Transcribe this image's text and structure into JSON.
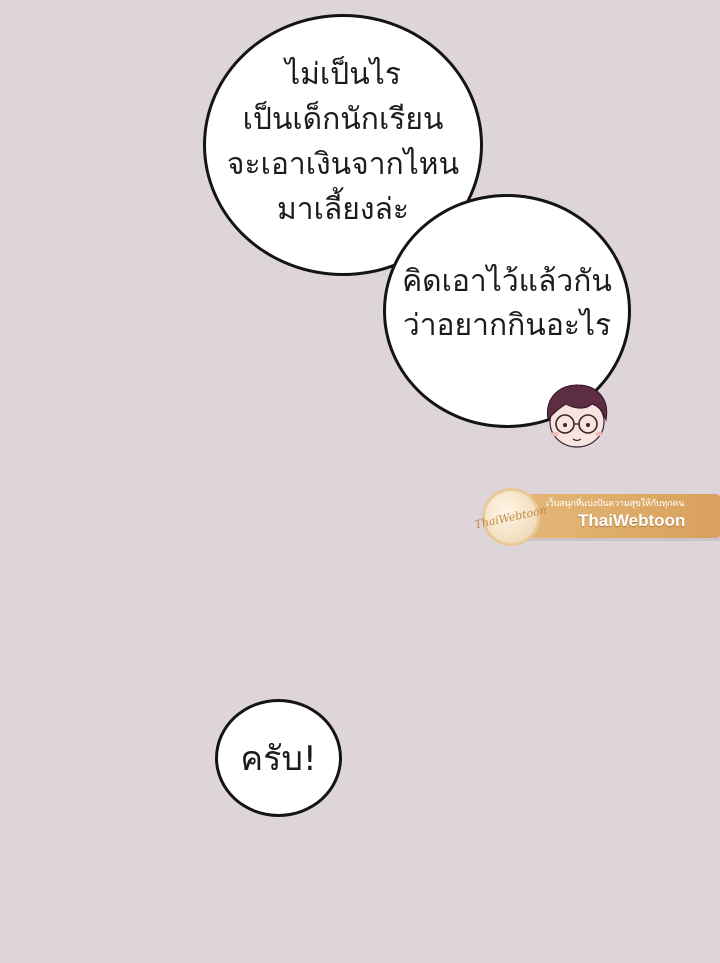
{
  "bubbles": {
    "top": "ไม่เป็นไร\nเป็นเด็กนักเรียน\nจะเอาเงินจากไหน\nมาเลี้ยงล่ะ",
    "middle": "คิดเอาไว้แล้วกัน\nว่าอยากกินอะไร",
    "bottom": "ครับ!"
  },
  "watermark": {
    "logo": "ThaiWebtoon",
    "tagline": "เว็บสนุกที่แบ่งปันความสุขให้กับทุกคน",
    "name": "ThaiWebtoon"
  },
  "colors": {
    "background": "#ddd5d9",
    "bubble": "#ffffff",
    "outline": "#141414",
    "watermark": "#e0ae6b"
  }
}
